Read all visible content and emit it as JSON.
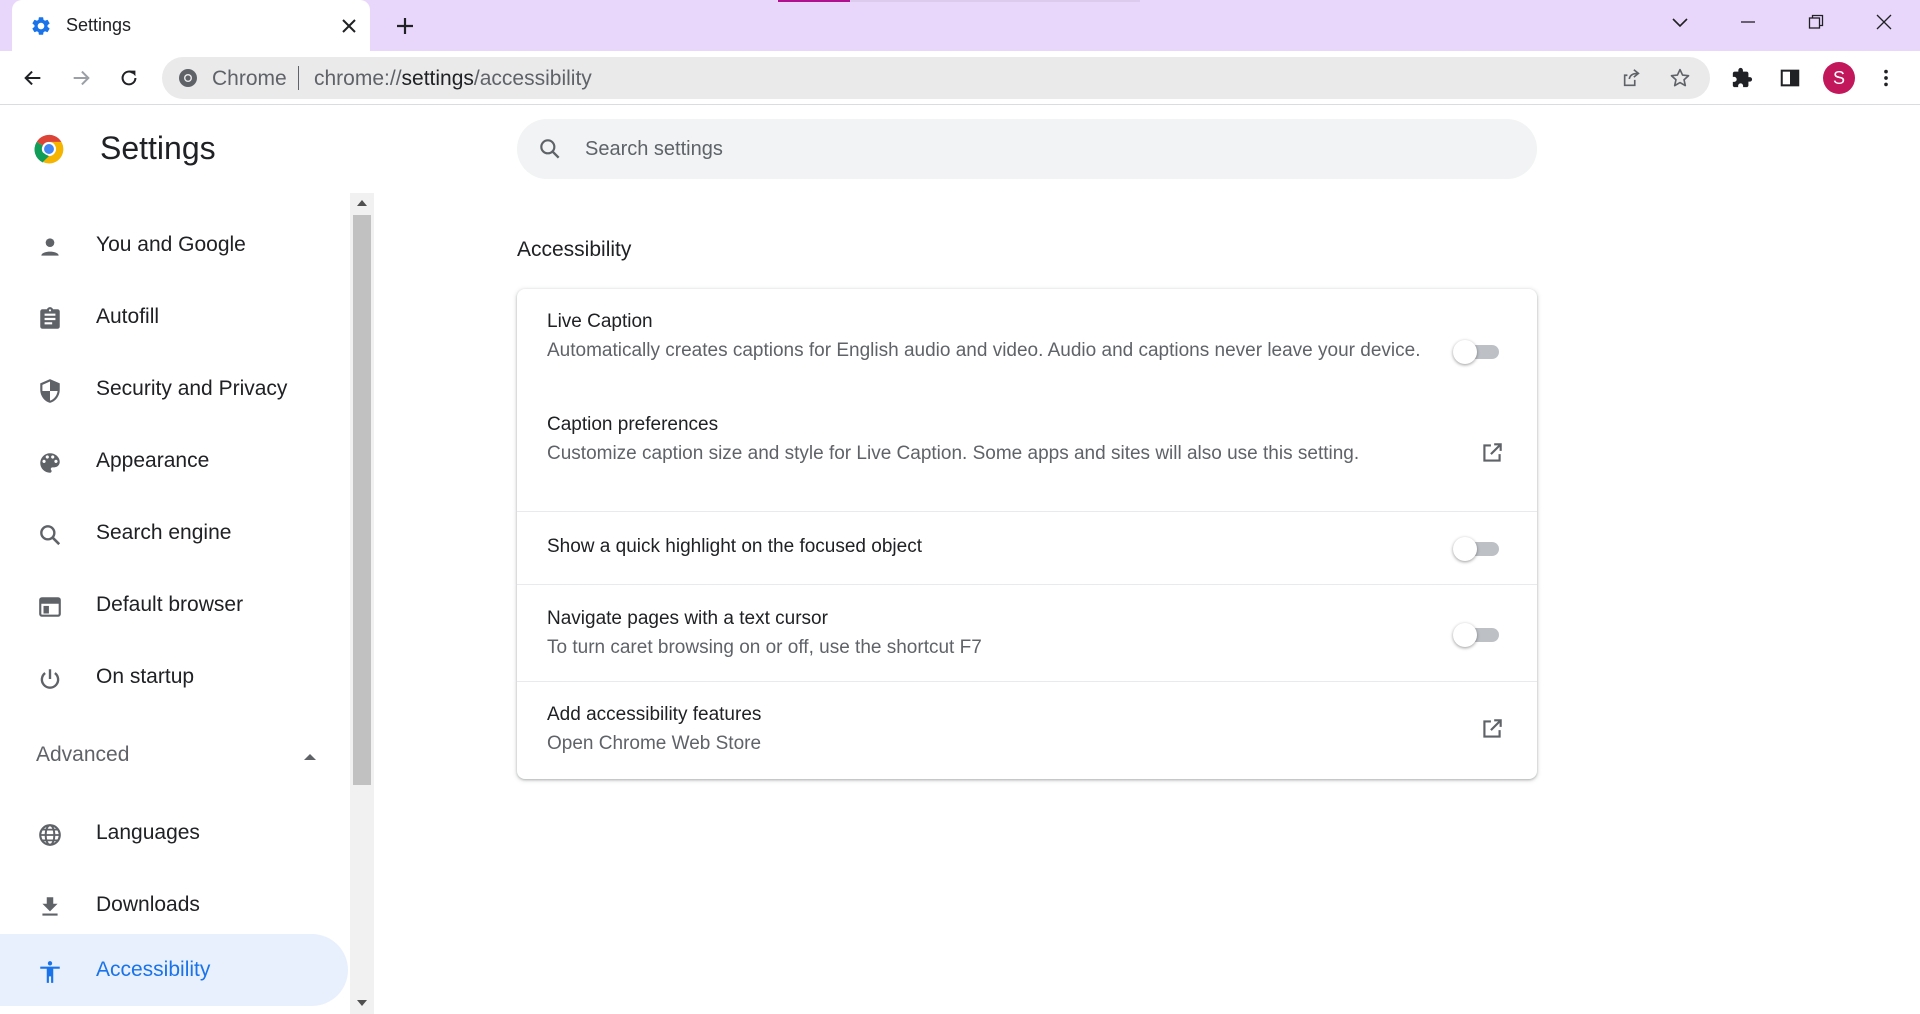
{
  "browser": {
    "tab": {
      "title": "Settings"
    },
    "omnibox": {
      "chip": "Chrome",
      "url_scheme": "chrome://",
      "url_host": "settings",
      "url_path": "/accessibility"
    },
    "avatar_initial": "S",
    "loading_progress": 0.2
  },
  "settings": {
    "title": "Settings",
    "search": {
      "placeholder": "Search settings"
    }
  },
  "sidebar": {
    "items": [
      {
        "label": "You and Google",
        "icon": "person-icon"
      },
      {
        "label": "Autofill",
        "icon": "clipboard-icon"
      },
      {
        "label": "Security and Privacy",
        "icon": "shield-icon"
      },
      {
        "label": "Appearance",
        "icon": "palette-icon"
      },
      {
        "label": "Search engine",
        "icon": "search-icon"
      },
      {
        "label": "Default browser",
        "icon": "browser-window-icon"
      },
      {
        "label": "On startup",
        "icon": "power-icon"
      }
    ],
    "advanced_label": "Advanced",
    "advanced_items": [
      {
        "label": "Languages",
        "icon": "globe-icon"
      },
      {
        "label": "Downloads",
        "icon": "download-icon"
      },
      {
        "label": "Accessibility",
        "icon": "accessibility-icon",
        "active": true
      }
    ]
  },
  "main": {
    "section_title": "Accessibility",
    "rows": [
      {
        "title": "Live Caption",
        "subtitle": "Automatically creates captions for English audio and video. Audio and captions never leave your device.",
        "control": "toggle",
        "enabled": false
      },
      {
        "title": "Caption preferences",
        "subtitle": "Customize caption size and style for Live Caption. Some apps and sites will also use this setting.",
        "control": "external-link"
      },
      {
        "title": "Show a quick highlight on the focused object",
        "subtitle": "",
        "control": "toggle",
        "enabled": false
      },
      {
        "title": "Navigate pages with a text cursor",
        "subtitle": "To turn caret browsing on or off, use the shortcut F7",
        "control": "toggle",
        "enabled": false
      },
      {
        "title": "Add accessibility features",
        "subtitle": "Open Chrome Web Store",
        "control": "external-link"
      }
    ]
  },
  "colors": {
    "titlebar": "#e9d7fb",
    "accent": "#1a73e8",
    "active_nav_bg": "#e8f0fe",
    "avatar": "#c2185b",
    "progress": "#b0118f"
  }
}
